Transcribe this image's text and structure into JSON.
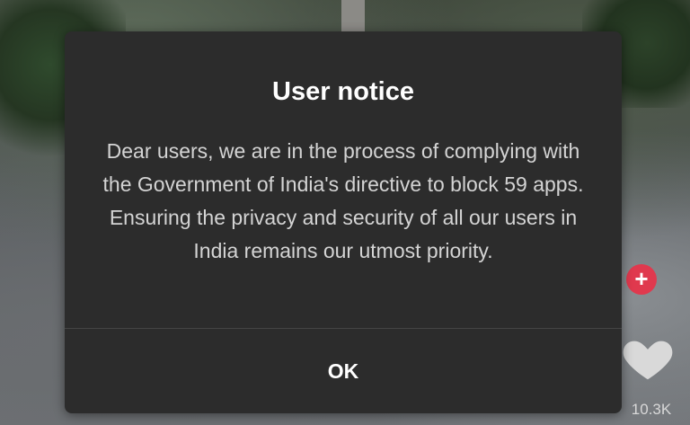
{
  "dialog": {
    "title": "User notice",
    "message": "Dear users, we are in the process of complying with the Government of India's directive to block 59 apps. Ensuring the privacy and security of all our users in India remains our utmost priority.",
    "ok_label": "OK"
  },
  "background_ui": {
    "add_icon": "+",
    "like_count": "10.3K",
    "icons": [
      "plus-icon",
      "heart-icon"
    ]
  },
  "colors": {
    "dialog_bg": "#2c2c2c",
    "title_text": "#ffffff",
    "body_text": "#d4d4d4",
    "accent_red": "#e0394e"
  }
}
